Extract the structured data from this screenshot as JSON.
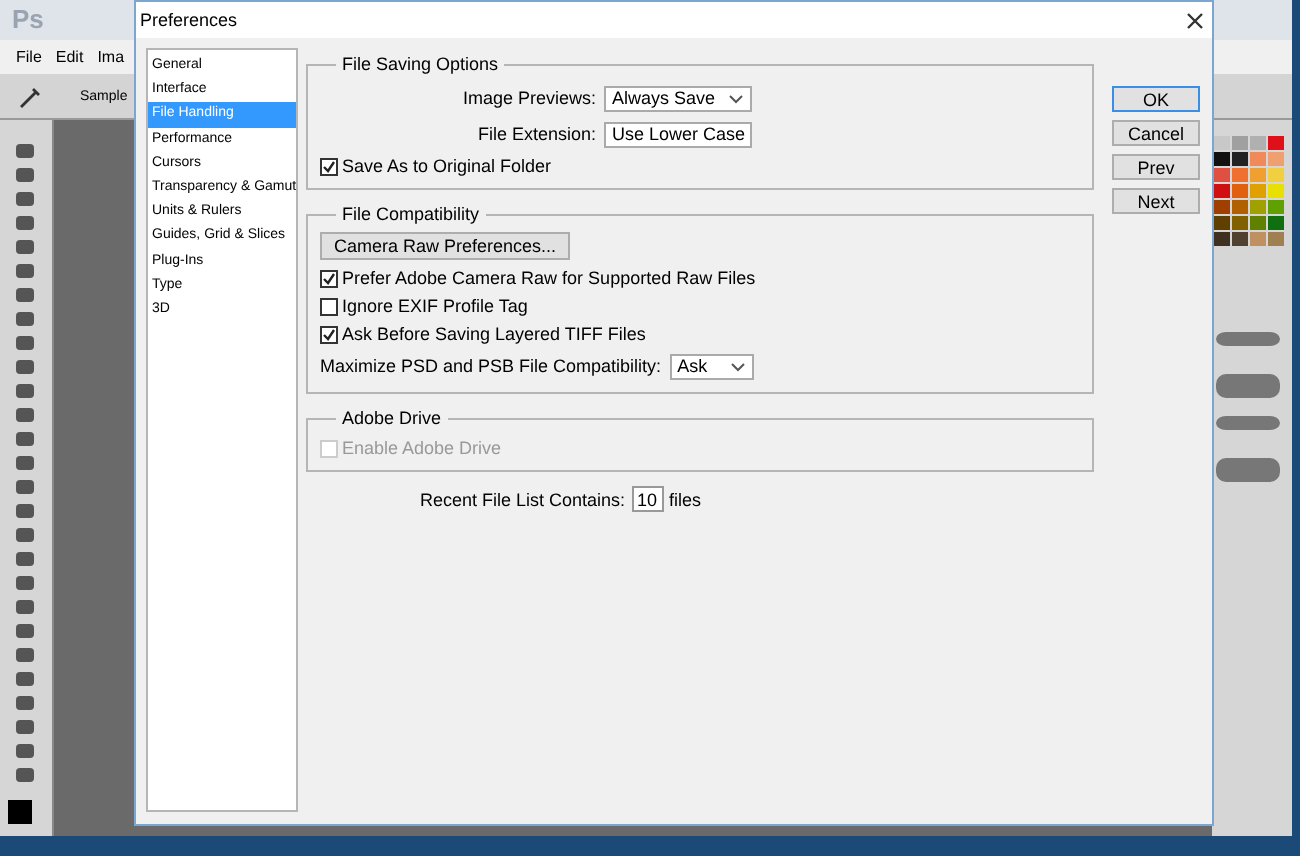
{
  "app": {
    "logo": "Ps",
    "menu": [
      "File",
      "Edit",
      "Ima"
    ],
    "options_label": "Sample"
  },
  "dialog": {
    "title": "Preferences",
    "categories": [
      {
        "label": "General",
        "selected": false
      },
      {
        "label": "Interface",
        "selected": false
      },
      {
        "label": "File Handling",
        "selected": true
      },
      {
        "label": "Performance",
        "selected": false
      },
      {
        "label": "Cursors",
        "selected": false
      },
      {
        "label": "Transparency & Gamut",
        "selected": false
      },
      {
        "label": "Units & Rulers",
        "selected": false
      },
      {
        "label": "Guides, Grid & Slices",
        "selected": false
      },
      {
        "label": "Plug-Ins",
        "selected": false
      },
      {
        "label": "Type",
        "selected": false
      },
      {
        "label": "3D",
        "selected": false
      }
    ],
    "sections": [
      {
        "title": "File Saving Options",
        "rows": [
          {
            "kind": "select",
            "label": "Image Previews:",
            "value": "Always Save"
          },
          {
            "kind": "select",
            "label": "File Extension:",
            "value": "Use Lower Case"
          },
          {
            "kind": "checkbox",
            "label": "Save As to Original Folder",
            "checked": true,
            "disabled": false
          }
        ]
      },
      {
        "title": "File Compatibility",
        "rows": [
          {
            "kind": "button",
            "label": "Camera Raw Preferences..."
          },
          {
            "kind": "checkbox",
            "label": "Prefer Adobe Camera Raw for Supported Raw Files",
            "checked": true,
            "disabled": false
          },
          {
            "kind": "checkbox",
            "label": "Ignore EXIF Profile Tag",
            "checked": false,
            "disabled": false
          },
          {
            "kind": "checkbox",
            "label": "Ask Before Saving Layered TIFF Files",
            "checked": true,
            "disabled": false
          },
          {
            "kind": "inline-select",
            "label": "Maximize PSD and PSB File Compatibility:",
            "value": "Ask"
          }
        ]
      },
      {
        "title": "Adobe Drive",
        "rows": [
          {
            "kind": "checkbox",
            "label": "Enable Adobe Drive",
            "checked": false,
            "disabled": true
          }
        ]
      }
    ],
    "recent_files": {
      "label": "Recent File List Contains:",
      "value": "10",
      "suffix": "files"
    },
    "buttons": [
      {
        "label": "OK",
        "default": true
      },
      {
        "label": "Cancel",
        "default": false
      },
      {
        "label": "Prev",
        "default": false
      },
      {
        "label": "Next",
        "default": false
      }
    ]
  }
}
